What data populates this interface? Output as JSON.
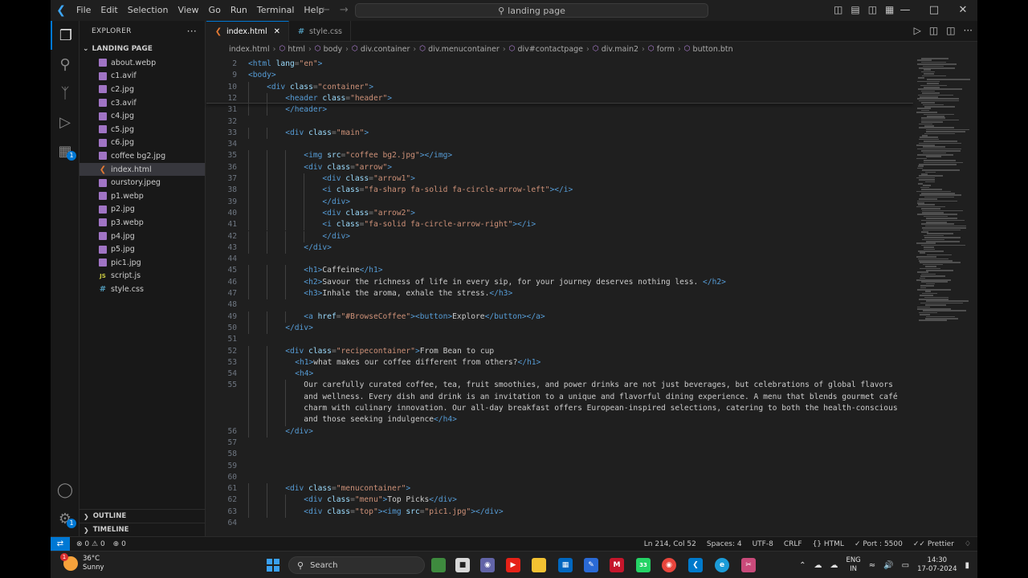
{
  "titlebar": {
    "menus": [
      "File",
      "Edit",
      "Selection",
      "View",
      "Go",
      "Run",
      "Terminal",
      "Help"
    ],
    "search": "landing page"
  },
  "sidebar": {
    "header": "EXPLORER",
    "folder": "LANDING PAGE",
    "files": [
      {
        "name": "about.webp",
        "type": "img"
      },
      {
        "name": "c1.avif",
        "type": "img"
      },
      {
        "name": "c2.jpg",
        "type": "img"
      },
      {
        "name": "c3.avif",
        "type": "img"
      },
      {
        "name": "c4.jpg",
        "type": "img"
      },
      {
        "name": "c5.jpg",
        "type": "img"
      },
      {
        "name": "c6.jpg",
        "type": "img"
      },
      {
        "name": "coffee bg2.jpg",
        "type": "img"
      },
      {
        "name": "index.html",
        "type": "html",
        "selected": true
      },
      {
        "name": "ourstory.jpeg",
        "type": "img"
      },
      {
        "name": "p1.webp",
        "type": "img"
      },
      {
        "name": "p2.jpg",
        "type": "img"
      },
      {
        "name": "p3.webp",
        "type": "img"
      },
      {
        "name": "p4.jpg",
        "type": "img"
      },
      {
        "name": "p5.jpg",
        "type": "img"
      },
      {
        "name": "pic1.jpg",
        "type": "img"
      },
      {
        "name": "script.js",
        "type": "js"
      },
      {
        "name": "style.css",
        "type": "css"
      }
    ],
    "outline": "OUTLINE",
    "timeline": "TIMELINE"
  },
  "tabs": [
    {
      "label": "index.html",
      "icon": "html-icon",
      "active": true
    },
    {
      "label": "style.css",
      "icon": "css-icon",
      "active": false
    }
  ],
  "breadcrumb": [
    "index.html",
    "html",
    "body",
    "div.container",
    "div.menucontainer",
    "div#contactpage",
    "div.main2",
    "form",
    "button.btn"
  ],
  "code": [
    {
      "n": "2",
      "ind": 0,
      "t": [
        [
          "tag",
          "<html "
        ],
        [
          "attr",
          "lang"
        ],
        [
          "punc",
          "="
        ],
        [
          "str",
          "\"en\""
        ],
        [
          "tag",
          ">"
        ]
      ]
    },
    {
      "n": "9",
      "ind": 0,
      "t": [
        [
          "tag",
          "<body>"
        ]
      ]
    },
    {
      "n": "10",
      "ind": 1,
      "t": [
        [
          "tag",
          "<div "
        ],
        [
          "attr",
          "class"
        ],
        [
          "punc",
          "="
        ],
        [
          "str",
          "\"container\""
        ],
        [
          "tag",
          ">"
        ]
      ]
    },
    {
      "n": "12",
      "ind": 2,
      "t": [
        [
          "tag",
          "<header "
        ],
        [
          "attr",
          "class"
        ],
        [
          "punc",
          "="
        ],
        [
          "str",
          "\"header\""
        ],
        [
          "tag",
          ">"
        ]
      ]
    },
    {
      "n": "31",
      "ind": 2,
      "t": [
        [
          "tag",
          "</header>"
        ]
      ]
    },
    {
      "n": "32",
      "ind": 0,
      "t": []
    },
    {
      "n": "33",
      "ind": 2,
      "t": [
        [
          "tag",
          "<div "
        ],
        [
          "attr",
          "class"
        ],
        [
          "punc",
          "="
        ],
        [
          "str",
          "\"main\""
        ],
        [
          "tag",
          ">"
        ]
      ]
    },
    {
      "n": "34",
      "ind": 0,
      "t": []
    },
    {
      "n": "35",
      "ind": 3,
      "t": [
        [
          "tag",
          "<img "
        ],
        [
          "attr",
          "src"
        ],
        [
          "punc",
          "="
        ],
        [
          "str",
          "\"coffee bg2.jpg\""
        ],
        [
          "tag",
          "></img>"
        ]
      ]
    },
    {
      "n": "36",
      "ind": 3,
      "t": [
        [
          "tag",
          "<div "
        ],
        [
          "attr",
          "class"
        ],
        [
          "punc",
          "="
        ],
        [
          "str",
          "\"arrow\""
        ],
        [
          "tag",
          ">"
        ]
      ]
    },
    {
      "n": "37",
      "ind": 4,
      "t": [
        [
          "tag",
          "<div "
        ],
        [
          "attr",
          "class"
        ],
        [
          "punc",
          "="
        ],
        [
          "str",
          "\"arrow1\""
        ],
        [
          "tag",
          ">"
        ]
      ]
    },
    {
      "n": "38",
      "ind": 4,
      "t": [
        [
          "tag",
          "<i "
        ],
        [
          "attr",
          "class"
        ],
        [
          "punc",
          "="
        ],
        [
          "str",
          "\"fa-sharp fa-solid fa-circle-arrow-left\""
        ],
        [
          "tag",
          "></i>"
        ]
      ]
    },
    {
      "n": "39",
      "ind": 4,
      "t": [
        [
          "tag",
          "</div>"
        ]
      ]
    },
    {
      "n": "40",
      "ind": 4,
      "t": [
        [
          "tag",
          "<div "
        ],
        [
          "attr",
          "class"
        ],
        [
          "punc",
          "="
        ],
        [
          "str",
          "\"arrow2\""
        ],
        [
          "tag",
          ">"
        ]
      ]
    },
    {
      "n": "41",
      "ind": 4,
      "t": [
        [
          "tag",
          "<i "
        ],
        [
          "attr",
          "class"
        ],
        [
          "punc",
          "="
        ],
        [
          "str",
          "\"fa-solid fa-circle-arrow-right\""
        ],
        [
          "tag",
          "></i>"
        ]
      ]
    },
    {
      "n": "42",
      "ind": 4,
      "t": [
        [
          "tag",
          "</div>"
        ]
      ]
    },
    {
      "n": "43",
      "ind": 3,
      "t": [
        [
          "tag",
          "</div>"
        ]
      ]
    },
    {
      "n": "44",
      "ind": 0,
      "t": []
    },
    {
      "n": "45",
      "ind": 3,
      "t": [
        [
          "tag",
          "<h1>"
        ],
        [
          "txt",
          "Caffeine"
        ],
        [
          "tag",
          "</h1>"
        ]
      ]
    },
    {
      "n": "46",
      "ind": 3,
      "t": [
        [
          "tag",
          "<h2>"
        ],
        [
          "txt",
          "Savour the richness of life in every sip, for your journey deserves nothing less. "
        ],
        [
          "tag",
          "</h2>"
        ]
      ]
    },
    {
      "n": "47",
      "ind": 3,
      "t": [
        [
          "tag",
          "<h3>"
        ],
        [
          "txt",
          "Inhale the aroma, exhale the stress."
        ],
        [
          "tag",
          "</h3>"
        ]
      ]
    },
    {
      "n": "48",
      "ind": 0,
      "t": []
    },
    {
      "n": "49",
      "ind": 3,
      "t": [
        [
          "tag",
          "<a "
        ],
        [
          "attr",
          "href"
        ],
        [
          "punc",
          "="
        ],
        [
          "str",
          "\"#BrowseCoffee\""
        ],
        [
          "tag",
          "><button>"
        ],
        [
          "txt",
          "Explore"
        ],
        [
          "tag",
          "</button></a>"
        ]
      ]
    },
    {
      "n": "50",
      "ind": 2,
      "t": [
        [
          "tag",
          "</div>"
        ]
      ]
    },
    {
      "n": "51",
      "ind": 0,
      "t": []
    },
    {
      "n": "52",
      "ind": 2,
      "t": [
        [
          "tag",
          "<div "
        ],
        [
          "attr",
          "class"
        ],
        [
          "punc",
          "="
        ],
        [
          "str",
          "\"recipecontainer\""
        ],
        [
          "tag",
          ">"
        ],
        [
          "txt",
          "From Bean to cup"
        ]
      ]
    },
    {
      "n": "53",
      "ind": 2,
      "pad": 1,
      "t": [
        [
          "tag",
          "<h1>"
        ],
        [
          "txt",
          "what makes our coffee different from others?"
        ],
        [
          "tag",
          "</h1>"
        ]
      ]
    },
    {
      "n": "54",
      "ind": 2,
      "pad": 1,
      "t": [
        [
          "tag",
          "<h4>"
        ]
      ]
    },
    {
      "n": "55",
      "ind": 3,
      "t": [
        [
          "txt",
          "Our carefully curated coffee, tea, fruit smoothies, and power drinks are not just beverages, but celebrations of global flavors"
        ]
      ]
    },
    {
      "n": "",
      "ind": 3,
      "t": [
        [
          "txt",
          "and wellness. Every dish and drink is an invitation to a unique and flavorful dining experience. A menu that blends gourmet café"
        ]
      ]
    },
    {
      "n": "",
      "ind": 3,
      "t": [
        [
          "txt",
          "charm with culinary innovation. Our all-day breakfast offers European-inspired selections, catering to both the health-conscious"
        ]
      ]
    },
    {
      "n": "",
      "ind": 3,
      "t": [
        [
          "txt",
          "and those seeking indulgence"
        ],
        [
          "tag",
          "</h4>"
        ]
      ]
    },
    {
      "n": "56",
      "ind": 2,
      "t": [
        [
          "tag",
          "</div>"
        ]
      ]
    },
    {
      "n": "57",
      "ind": 0,
      "t": []
    },
    {
      "n": "58",
      "ind": 0,
      "t": []
    },
    {
      "n": "59",
      "ind": 0,
      "t": []
    },
    {
      "n": "60",
      "ind": 0,
      "t": []
    },
    {
      "n": "61",
      "ind": 2,
      "t": [
        [
          "tag",
          "<div "
        ],
        [
          "attr",
          "class"
        ],
        [
          "punc",
          "="
        ],
        [
          "str",
          "\"menucontainer\""
        ],
        [
          "tag",
          ">"
        ]
      ]
    },
    {
      "n": "62",
      "ind": 3,
      "t": [
        [
          "tag",
          "<div "
        ],
        [
          "attr",
          "class"
        ],
        [
          "punc",
          "="
        ],
        [
          "str",
          "\"menu\""
        ],
        [
          "tag",
          ">"
        ],
        [
          "txt",
          "Top Picks"
        ],
        [
          "tag",
          "</div>"
        ]
      ]
    },
    {
      "n": "63",
      "ind": 3,
      "t": [
        [
          "tag",
          "<div "
        ],
        [
          "attr",
          "class"
        ],
        [
          "punc",
          "="
        ],
        [
          "str",
          "\"top\""
        ],
        [
          "tag",
          "><img "
        ],
        [
          "attr",
          "src"
        ],
        [
          "punc",
          "="
        ],
        [
          "str",
          "\"pic1.jpg\""
        ],
        [
          "tag",
          "></div>"
        ]
      ]
    },
    {
      "n": "64",
      "ind": 0,
      "t": []
    }
  ],
  "statusbar": {
    "errors": "0",
    "warnings": "0",
    "ports": "0",
    "position": "Ln 214, Col 52",
    "spaces": "Spaces: 4",
    "encoding": "UTF-8",
    "eol": "CRLF",
    "language": "HTML",
    "port": "Port : 5500",
    "prettier": "Prettier"
  },
  "taskbar": {
    "temp": "36°C",
    "weather": "Sunny",
    "weather_badge": "1",
    "search": "Search",
    "whatsapp_badge": "33",
    "lang1": "ENG",
    "lang2": "IN",
    "time": "14:30",
    "date": "17-07-2024"
  },
  "colors": {
    "accent": "#0078d4",
    "tag": "#569cd6",
    "attr": "#9cdcfe",
    "string": "#ce9178"
  }
}
